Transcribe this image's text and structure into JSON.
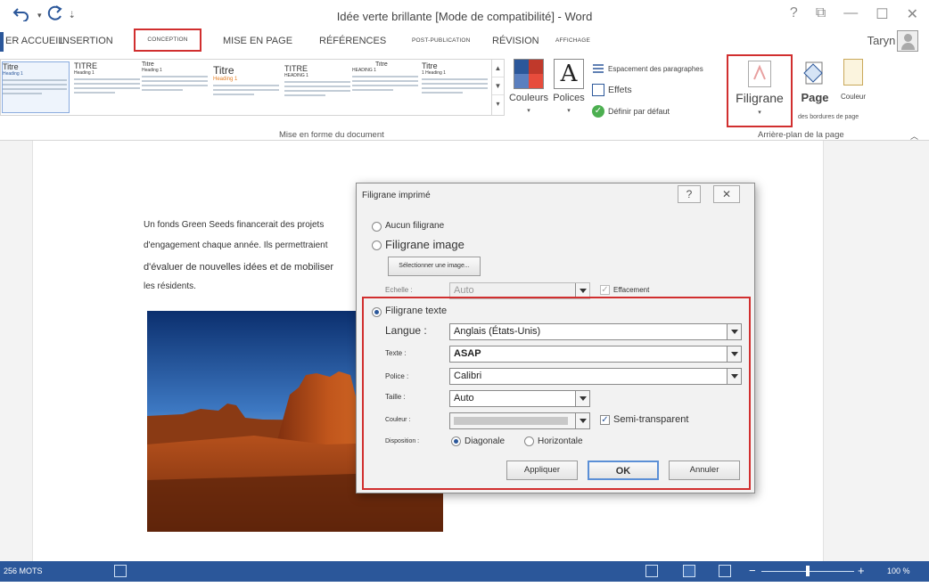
{
  "window": {
    "title": "Idée verte brillante [Mode de compatibilité] - Word",
    "controls": [
      "?",
      "⧉",
      "—",
      "☐",
      "✕"
    ]
  },
  "qat": {
    "undo_icon": "undo-icon",
    "redo_icon": "redo-icon",
    "more": "⇣"
  },
  "tabs": [
    {
      "label": "ER ACCUEIL"
    },
    {
      "label": "INSERTION"
    },
    {
      "label": "CONCEPTION"
    },
    {
      "label": "MISE EN PAGE"
    },
    {
      "label": "RÉFÉRENCES"
    },
    {
      "label": "POST-PUBLICATION"
    },
    {
      "label": "RÉVISION"
    },
    {
      "label": "AFFICHAGE"
    }
  ],
  "user": {
    "name": "Taryn"
  },
  "ribbon": {
    "styles": [
      {
        "title": "Titre",
        "heading": "Heading 1"
      },
      {
        "title": "TITRE",
        "heading": "Heading 1"
      },
      {
        "title": "Titre",
        "heading": "Heading 1"
      },
      {
        "title": "Titre",
        "heading": "Heading 1"
      },
      {
        "title": "TITRE",
        "heading": "HEADING 1"
      },
      {
        "title": "Titre",
        "heading": "HEADING 1"
      },
      {
        "title": "Titre",
        "heading": "1 Heading 1"
      }
    ],
    "doc_format_label": "Mise en forme du document",
    "colors_label": "Couleurs",
    "fonts_label": "Polices",
    "paragraph_spacing": "Espacement des paragraphes",
    "effects": "Effets",
    "set_default": "Définir par défaut",
    "watermark_label": "Filigrane",
    "page_label": "Page",
    "page_sub": "des bordures de page",
    "color_label": "Couleur",
    "page_bg_label": "Arrière-plan de la page",
    "colors": {
      "c1": "#2b579a",
      "c2": "#c0392b",
      "c3": "#5a7fbf",
      "c4": "#e74c3c"
    }
  },
  "document": {
    "lines": [
      "Un fonds Green Seeds financerait des projets",
      "d'engagement chaque année. Ils permettraient",
      "d'évaluer de nouvelles idées et de mobiliser",
      "les résidents."
    ]
  },
  "dialog": {
    "title": "Filigrane imprimé",
    "help": "?",
    "close": "✕",
    "no_watermark": "Aucun filigrane",
    "image_watermark": "Filigrane image",
    "select_image": "Sélectionner une image...",
    "scale_label": "Echelle :",
    "scale_value": "Auto",
    "washout": "Effacement",
    "text_watermark": "Filigrane texte",
    "language_label": "Langue :",
    "language_value": "Anglais (États-Unis)",
    "text_label": "Texte :",
    "text_value": "ASAP",
    "font_label": "Police :",
    "font_value": "Calibri",
    "size_label": "Taille :",
    "size_value": "Auto",
    "color_label": "Couleur :",
    "semi_transparent": "Semi-transparent",
    "layout_label": "Disposition :",
    "diagonal": "Diagonale",
    "horizontal": "Horizontale",
    "apply": "Appliquer",
    "ok": "OK",
    "cancel": "Annuler"
  },
  "status": {
    "words": "256 MOTS",
    "zoom": "100 %",
    "zoom_minus": "−",
    "zoom_plus": "+",
    "zoom_fraction": 0.5
  }
}
